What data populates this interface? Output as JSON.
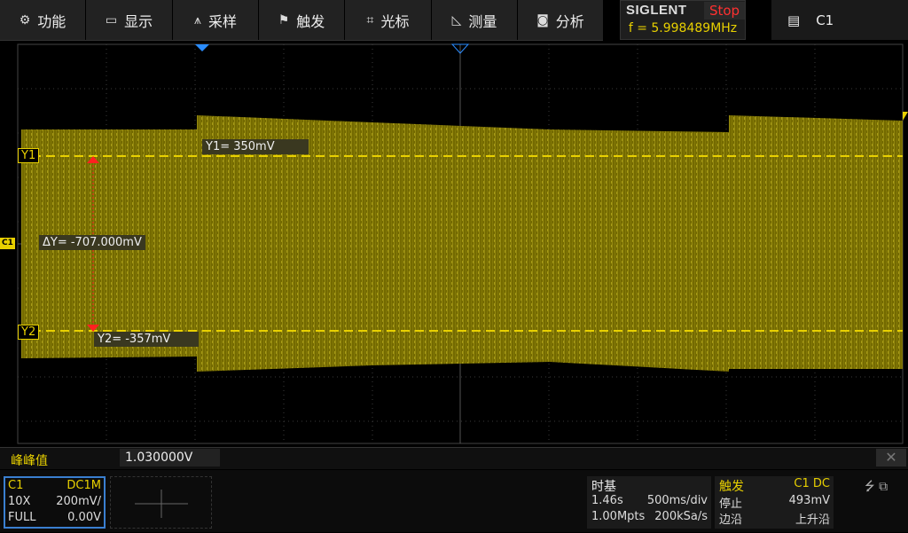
{
  "menu": [
    {
      "icon": "⚙",
      "label": "功能"
    },
    {
      "icon": "▭",
      "label": "显示"
    },
    {
      "icon": "⩚",
      "label": "采样"
    },
    {
      "icon": "⚑",
      "label": "触发"
    },
    {
      "icon": "⌗",
      "label": "光标"
    },
    {
      "icon": "◺",
      "label": "测量"
    },
    {
      "icon": "◙",
      "label": "分析"
    }
  ],
  "brand": {
    "name": "SIGLENT",
    "status": "Stop",
    "frequency": "f = 5.998489MHz"
  },
  "channel_selector": {
    "icon": "▤",
    "label": "C1"
  },
  "cursors": {
    "y1_label": "Y1",
    "y1_readout": "Y1= 350mV",
    "y2_label": "Y2",
    "y2_readout": "Y2= -357mV",
    "delta_readout": "ΔY= -707.000mV"
  },
  "channel_marker": "C1",
  "measurement": {
    "name": "峰峰值",
    "value": "1.030000V",
    "close": "✕"
  },
  "channel1": {
    "name": "C1",
    "coupling": "DC1M",
    "probe": "10X",
    "scale": "200mV/",
    "bandwidth": "FULL",
    "offset": "0.00V"
  },
  "timebase": {
    "title": "时基",
    "delay": "1.46s",
    "scale": "500ms/div",
    "memory": "1.00Mpts",
    "sample_rate": "200kSa/s"
  },
  "trigger": {
    "title": "触发",
    "source": "C1 DC",
    "state": "停止",
    "level": "493mV",
    "type": "边沿",
    "slope": "上升沿"
  },
  "colors": {
    "trace": "#e8d000",
    "cursor_marker": "#ff2020",
    "accent": "#3a7fd0"
  }
}
